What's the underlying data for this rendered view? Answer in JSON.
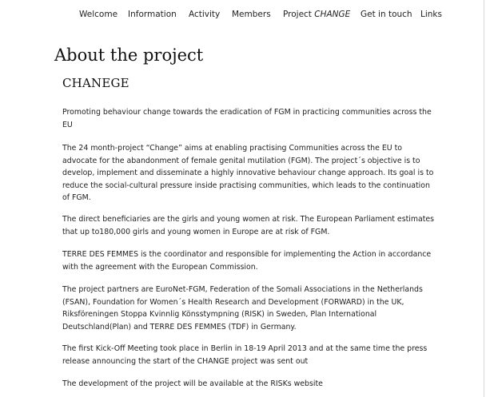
{
  "nav": {
    "items": [
      {
        "label": "Welcome"
      },
      {
        "label": "Information"
      },
      {
        "label": "Activity"
      },
      {
        "label": "Members"
      },
      {
        "label_prefix": "Project ",
        "label_em": "CHANGE"
      },
      {
        "label": "Get in touch"
      },
      {
        "label": "Links"
      }
    ]
  },
  "page_title": "About the project",
  "section_title": "CHANEGE",
  "paragraphs": [
    "Promoting behaviour change towards the eradication of FGM in practicing communities across the EU",
    "The 24 month-project “Change” aims at enabling practising Communities across the EU to advocate for the abandonment of female genital mutilation (FGM). The project´s objective is to develop, implement and disseminate a highly innovative behaviour change approach. Its goal is to reduce the social-cultural pressure inside practising communities, which leads to the continuation of FGM.",
    "The direct beneficiaries are the girls and young women at risk. The European Parliament estimates that up to180,000 girls and young women in Europe are at risk of FGM.",
    "TERRE DES FEMMES is the coordinator and responsible for implementing the Action in accordance with the agreement with the European Commission.",
    "The project partners are EuroNet-FGM, Federation of the Somali Associations in the Netherlands (FSAN), Foundation for Women´s Health Research and Development (FORWARD) in the UK, Riksföreningen Stoppa Kvinnlig Könsstympning (RISK) in Sweden, Plan International Deutschland(Plan) and TERRE DES FEMMES (TDF) in Germany.",
    "The first Kick-Off Meeting took place in Berlin in 18-19 April 2013 and at the same time the press release announcing the start of the CHANGE project was sent out",
    "The development of the project will be available at the RISKs website"
  ]
}
